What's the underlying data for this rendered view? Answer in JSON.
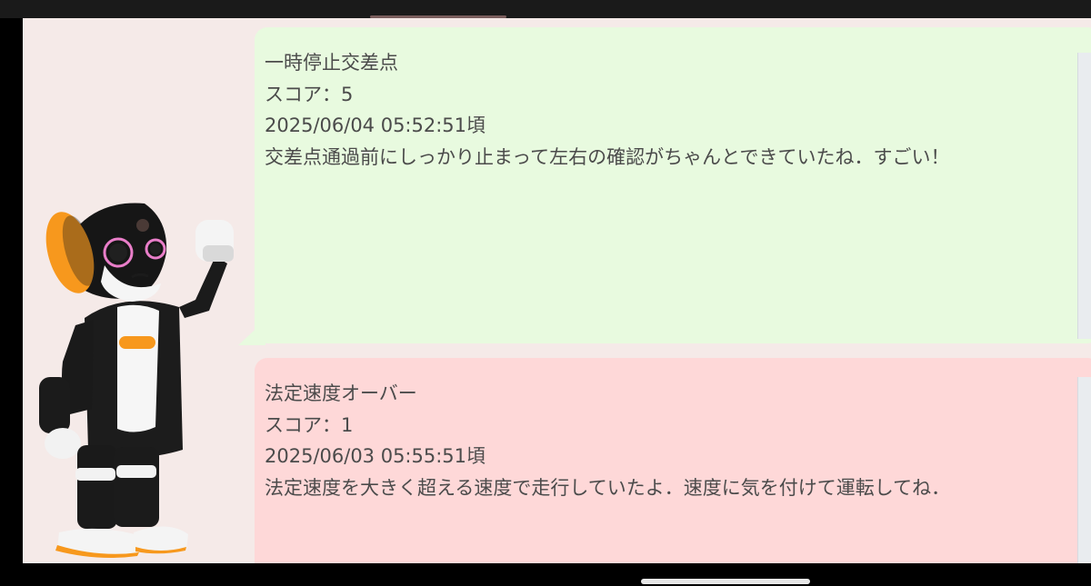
{
  "colors": {
    "app_background": "#f5eae8",
    "good_card": "#e8fadf",
    "bad_card": "#fed8d8",
    "text": "#4b4b4b",
    "robot_accent": "#f7981d"
  },
  "icons": {
    "mascot": "robohon-robot-illustration"
  },
  "messages": [
    {
      "title": "一時停止交差点",
      "score": "スコア：5",
      "datetime": "2025/06/04 05:52:51頃",
      "comment": "交差点通過前にしっかり止まって左右の確認がちゃんとできていたね．すごい！"
    },
    {
      "title": "法定速度オーバー",
      "score": "スコア：1",
      "datetime": "2025/06/03 05:55:51頃",
      "comment": "法定速度を大きく超える速度で走行していたよ．速度に気を付けて運転してね．"
    }
  ]
}
